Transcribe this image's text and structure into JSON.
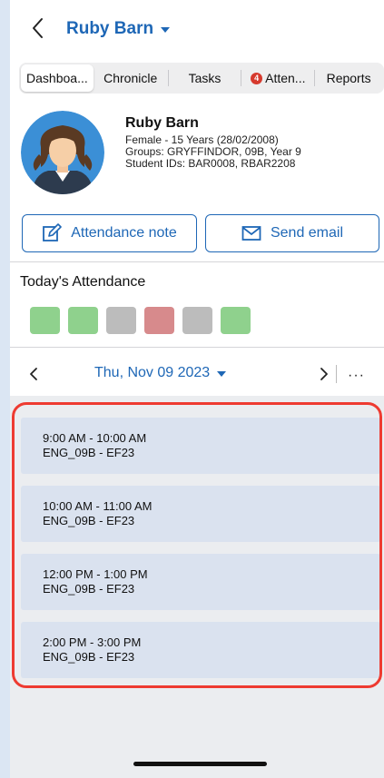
{
  "header": {
    "title": "Ruby Barn",
    "back_icon": "chevron-left-icon",
    "dropdown_icon": "caret-down-icon",
    "accent": "#1e67b6"
  },
  "tabs": [
    {
      "label": "Dashboa...",
      "selected": true
    },
    {
      "label": "Chronicle"
    },
    {
      "label": "Tasks"
    },
    {
      "label": "Atten...",
      "badge": "4"
    },
    {
      "label": "Reports"
    }
  ],
  "profile": {
    "name": "Ruby Barn",
    "gender_age": "Female - 15 Years (28/02/2008)",
    "groups": "Groups: GRYFFINDOR, 09B, Year 9",
    "student_ids": "Student IDs: BAR0008, RBAR2208"
  },
  "actions": {
    "attendance_note": "Attendance note",
    "send_email": "Send email"
  },
  "attendance": {
    "title": "Today's Attendance",
    "marks": [
      {
        "status": "present",
        "color": "#8fd18d"
      },
      {
        "status": "present",
        "color": "#8fd18d"
      },
      {
        "status": "none",
        "color": "#bcbcbc"
      },
      {
        "status": "absent",
        "color": "#d78a8c"
      },
      {
        "status": "none",
        "color": "#bcbcbc"
      },
      {
        "status": "present",
        "color": "#8fd18d"
      }
    ]
  },
  "datebar": {
    "date": "Thu, Nov 09 2023",
    "more": "···"
  },
  "lessons": [
    {
      "time": "9:00 AM - 10:00 AM",
      "class": "ENG_09B - EF23"
    },
    {
      "time": "10:00 AM - 11:00 AM",
      "class": "ENG_09B - EF23"
    },
    {
      "time": "12:00 PM - 1:00 PM",
      "class": "ENG_09B - EF23"
    },
    {
      "time": "2:00 PM - 3:00 PM",
      "class": "ENG_09B - EF23"
    }
  ]
}
